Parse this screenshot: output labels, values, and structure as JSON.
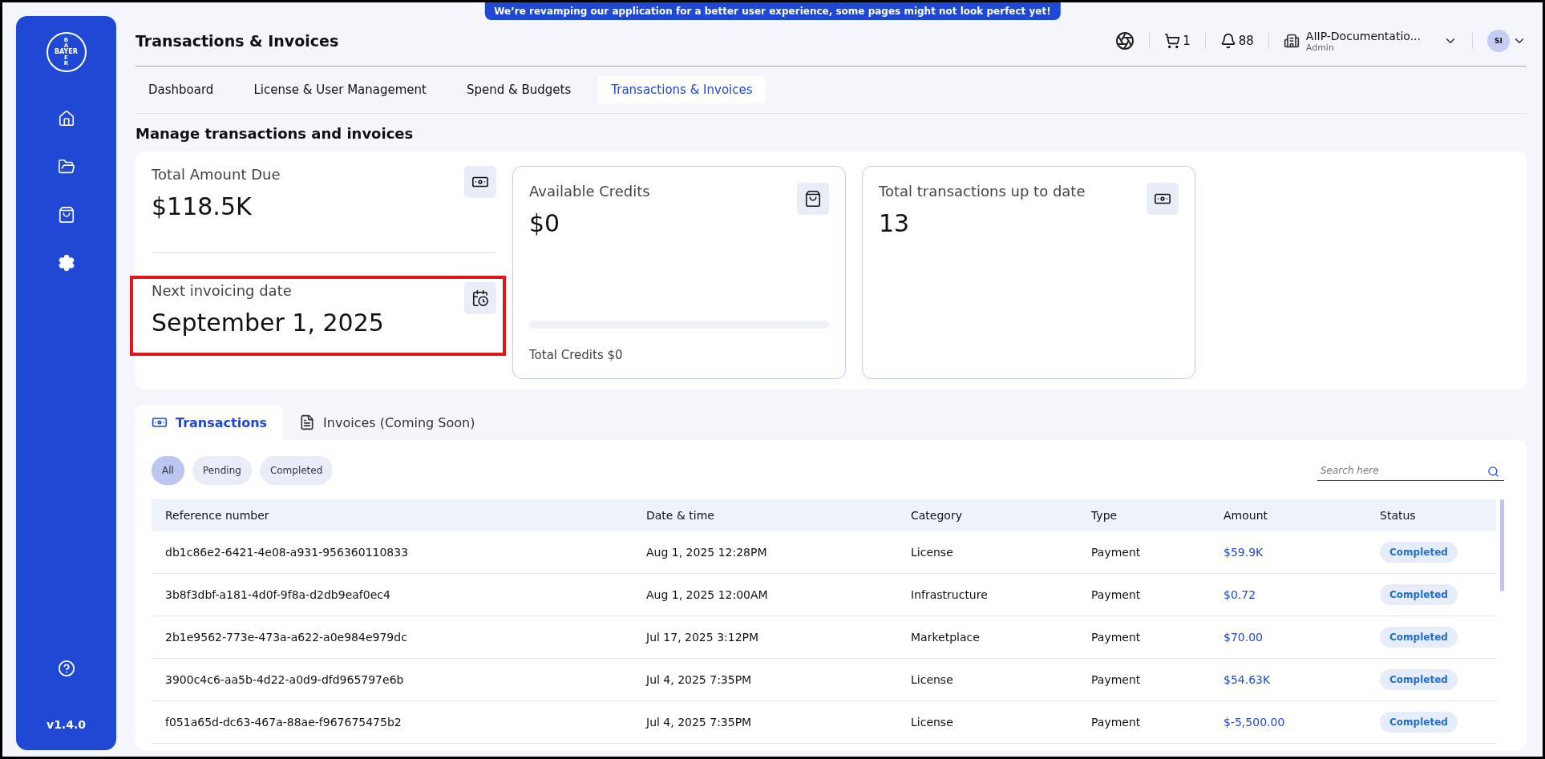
{
  "banner": "We’re revamping our application for a better user experience, some pages might not look perfect yet!",
  "sidebar": {
    "logo": {
      "top": "BA",
      "horizontal": "BAYER",
      "bottom": "ER"
    },
    "items": [
      {
        "selected": false
      },
      {
        "selected": false
      },
      {
        "selected": false
      },
      {
        "selected": true
      }
    ],
    "version": "v1.4.0"
  },
  "header": {
    "title": "Transactions & Invoices",
    "cart_count": "1",
    "notification_count": "88",
    "org": {
      "name": "AIIP-Documentatio...",
      "role": "Admin"
    },
    "avatar": "SI"
  },
  "nav_tabs": [
    {
      "label": "Dashboard",
      "selected": false
    },
    {
      "label": "License & User Management",
      "selected": false
    },
    {
      "label": "Spend & Budgets",
      "selected": false
    },
    {
      "label": "Transactions & Invoices",
      "selected": true
    }
  ],
  "section_title": "Manage transactions and invoices",
  "summary": {
    "total_due": {
      "label": "Total Amount Due",
      "value": "$118.5K"
    },
    "next_invoice": {
      "label": "Next invoicing date",
      "value": "September 1, 2025",
      "highlighted": true
    },
    "credits": {
      "label": "Available Credits",
      "value": "$0",
      "level": 0,
      "footer": "Total Credits $0"
    },
    "transactions": {
      "label": "Total transactions up to date",
      "value": "13"
    }
  },
  "content_tabs": [
    {
      "label": "Transactions",
      "selected": true
    },
    {
      "label": "Invoices (Coming Soon)",
      "selected": false
    }
  ],
  "filters": [
    {
      "label": "All",
      "selected": true
    },
    {
      "label": "Pending",
      "selected": false
    },
    {
      "label": "Completed",
      "selected": false
    }
  ],
  "search": {
    "placeholder": "Search here"
  },
  "table": {
    "columns": [
      "Reference number",
      "Date & time",
      "Category",
      "Type",
      "Amount",
      "Status"
    ],
    "rows": [
      {
        "reference": "db1c86e2-6421-4e08-a931-956360110833",
        "date": "Aug 1, 2025 12:28PM",
        "category": "License",
        "type": "Payment",
        "amount": "$59.9K",
        "status": "Completed"
      },
      {
        "reference": "3b8f3dbf-a181-4d0f-9f8a-d2db9eaf0ec4",
        "date": "Aug 1, 2025 12:00AM",
        "category": "Infrastructure",
        "type": "Payment",
        "amount": "$0.72",
        "status": "Completed"
      },
      {
        "reference": "2b1e9562-773e-473a-a622-a0e984e979dc",
        "date": "Jul 17, 2025 3:12PM",
        "category": "Marketplace",
        "type": "Payment",
        "amount": "$70.00",
        "status": "Completed"
      },
      {
        "reference": "3900c4c6-aa5b-4d22-a0d9-dfd965797e6b",
        "date": "Jul 4, 2025 7:35PM",
        "category": "License",
        "type": "Payment",
        "amount": "$54.63K",
        "status": "Completed"
      },
      {
        "reference": "f051a65d-dc63-467a-88ae-f967675475b2",
        "date": "Jul 4, 2025 7:35PM",
        "category": "License",
        "type": "Payment",
        "amount": "$-5,500.00",
        "status": "Completed"
      }
    ]
  }
}
